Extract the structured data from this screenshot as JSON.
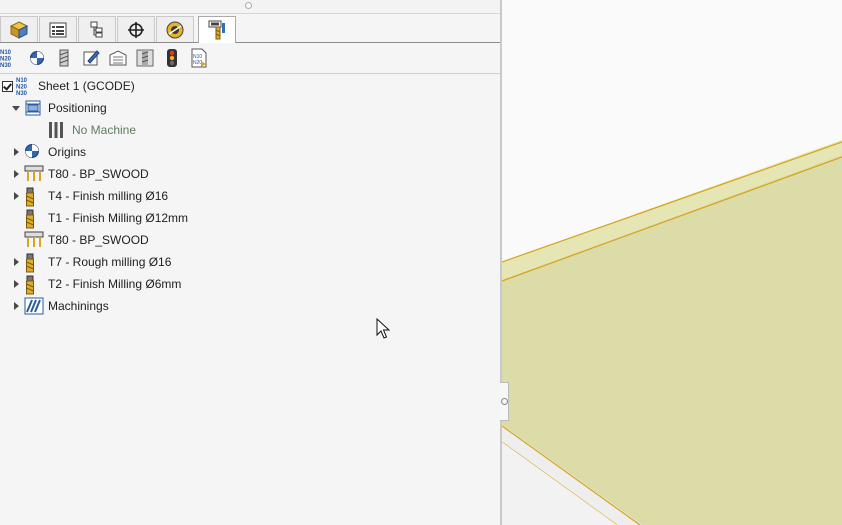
{
  "tabs": [
    {
      "name": "tab-feature-manager",
      "icon": "cube-icon"
    },
    {
      "name": "tab-property-manager",
      "icon": "list-icon"
    },
    {
      "name": "tab-configuration-manager",
      "icon": "configuration-icon"
    },
    {
      "name": "tab-dimxpert-manager",
      "icon": "crosshair-icon"
    },
    {
      "name": "tab-display-manager",
      "icon": "display-icon"
    },
    {
      "name": "tab-cam-manager",
      "icon": "cam-icon"
    }
  ],
  "toolbar": [
    {
      "name": "nc-code-button",
      "icon": "n10-n20-n30-icon"
    },
    {
      "name": "origins-button",
      "icon": "origin-icon"
    },
    {
      "name": "tool-button",
      "icon": "tool-icon"
    },
    {
      "name": "edit-button",
      "icon": "edit-icon"
    },
    {
      "name": "program-button",
      "icon": "program-icon"
    },
    {
      "name": "simulation-button",
      "icon": "simulation-icon"
    },
    {
      "name": "status-button",
      "icon": "traffic-light-icon"
    },
    {
      "name": "export-gcode-button",
      "icon": "gcode-file-icon"
    }
  ],
  "tree": {
    "root": {
      "label": "Sheet 1 (GCODE)",
      "checked": true
    },
    "items": [
      {
        "label": "Positioning",
        "icon": "positioning-icon",
        "expander": "down"
      },
      {
        "label": "No Machine",
        "icon": "machine-icon",
        "expander": "none",
        "muted": true
      },
      {
        "label": "Origins",
        "icon": "origin-icon",
        "expander": "right"
      },
      {
        "label": "T80 - BP_SWOOD",
        "icon": "drill-block-icon",
        "expander": "right"
      },
      {
        "label": "T4 - Finish milling Ø16",
        "icon": "mill-tool-icon",
        "expander": "right"
      },
      {
        "label": "T1 - Finish Milling Ø12mm",
        "icon": "mill-tool-icon",
        "expander": "none"
      },
      {
        "label": "T80 - BP_SWOOD",
        "icon": "drill-block-icon",
        "expander": "none"
      },
      {
        "label": "T7 - Rough milling Ø16",
        "icon": "mill-tool-icon",
        "expander": "right"
      },
      {
        "label": "T2 - Finish Milling Ø6mm",
        "icon": "mill-tool-icon",
        "expander": "right"
      },
      {
        "label": "Machinings",
        "icon": "machinings-icon",
        "expander": "right"
      }
    ]
  },
  "colors": {
    "panel": "#f5f5f5",
    "part_face": "#dcdca6",
    "part_edge": "#d4a017",
    "tool_gold": "#d9a521"
  }
}
